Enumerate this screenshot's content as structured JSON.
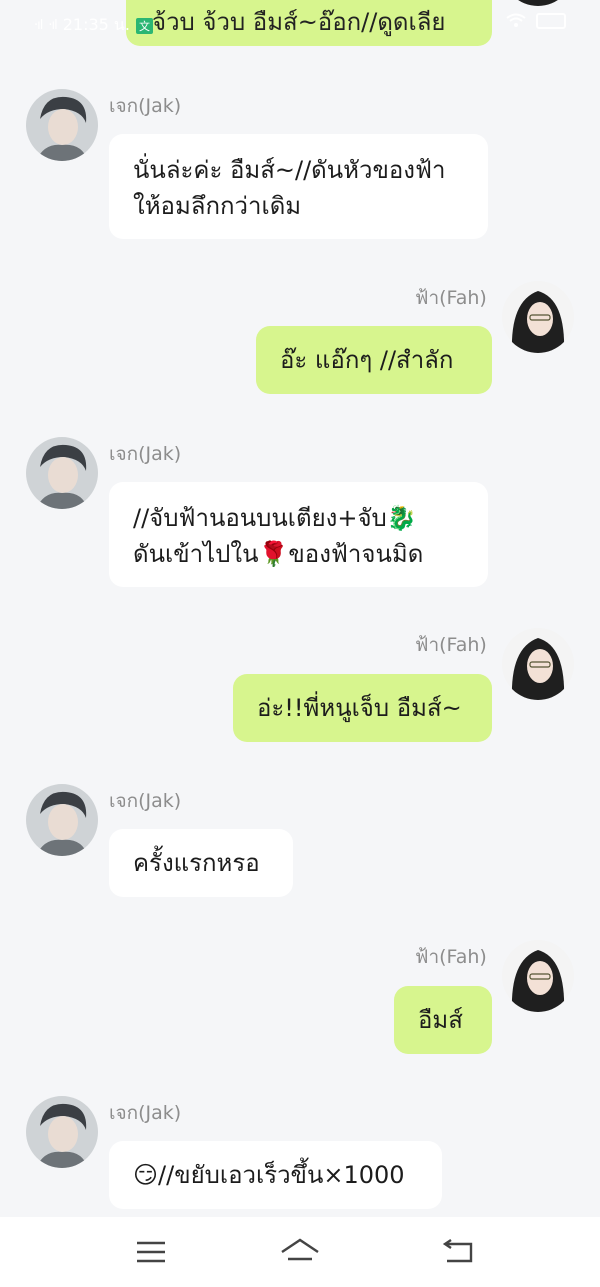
{
  "status_bar": {
    "signal1": "·ıl",
    "signal2": "·ıl",
    "time": "21:35 น.",
    "app_badge": "文"
  },
  "messages": [
    {
      "sender": "ฟ้า(Fah)",
      "side": "right",
      "lines": [
        "จ้วบ จ้วบ อืมส์~อ๊อก//ดูดเลีย"
      ]
    },
    {
      "sender": "เจก(Jak)",
      "side": "left",
      "lines": [
        "นั่นล่ะค่ะ อืมส์~//ดันหัวของฟ้า",
        "ให้อมลึกกว่าเดิม"
      ]
    },
    {
      "sender": "ฟ้า(Fah)",
      "side": "right",
      "lines": [
        "อ๊ะ แอ๊กๆ //สำลัก"
      ]
    },
    {
      "sender": "เจก(Jak)",
      "side": "left",
      "lines": [
        "//จับฟ้านอนบนเตียง+จับ🐉",
        "ดันเข้าไปใน🌹ของฟ้าจนมิด"
      ]
    },
    {
      "sender": "ฟ้า(Fah)",
      "side": "right",
      "lines": [
        "อ่ะ!!พี่หนูเจ็บ อืมส์~"
      ]
    },
    {
      "sender": "เจก(Jak)",
      "side": "left",
      "lines": [
        "ครั้งแรกหรอ"
      ]
    },
    {
      "sender": "ฟ้า(Fah)",
      "side": "right",
      "lines": [
        "อืมส์"
      ]
    },
    {
      "sender": "เจก(Jak)",
      "side": "left",
      "lines": [
        "😏//ขยับเอวเร็วขึ้น×1000"
      ]
    }
  ],
  "colors": {
    "background": "#f5f6f8",
    "bubble_left": "#ffffff",
    "bubble_right": "#d7f58e",
    "sender_name": "#8d8d8d"
  },
  "nav": {
    "menu_icon": "menu-icon",
    "home_icon": "home-icon",
    "back_icon": "back-icon"
  }
}
